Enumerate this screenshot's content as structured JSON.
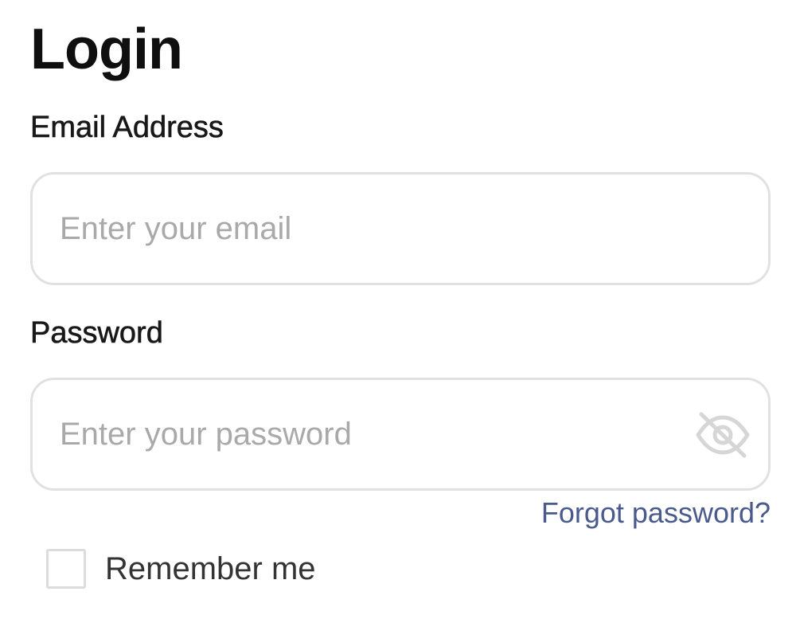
{
  "form": {
    "title": "Login",
    "email": {
      "label": "Email Address",
      "value": "",
      "placeholder": "Enter your email"
    },
    "password": {
      "label": "Password",
      "value": "",
      "placeholder": "Enter your password",
      "toggle_icon": "eye-off-icon"
    },
    "forgot_link": "Forgot password?",
    "remember": {
      "label": "Remember me",
      "checked": false
    }
  },
  "colors": {
    "text": "#0f0f0f",
    "placeholder": "#a9a9a9",
    "field_border": "#e1e1e1",
    "link": "#4a5a8c",
    "icon": "#d6d6d6"
  }
}
